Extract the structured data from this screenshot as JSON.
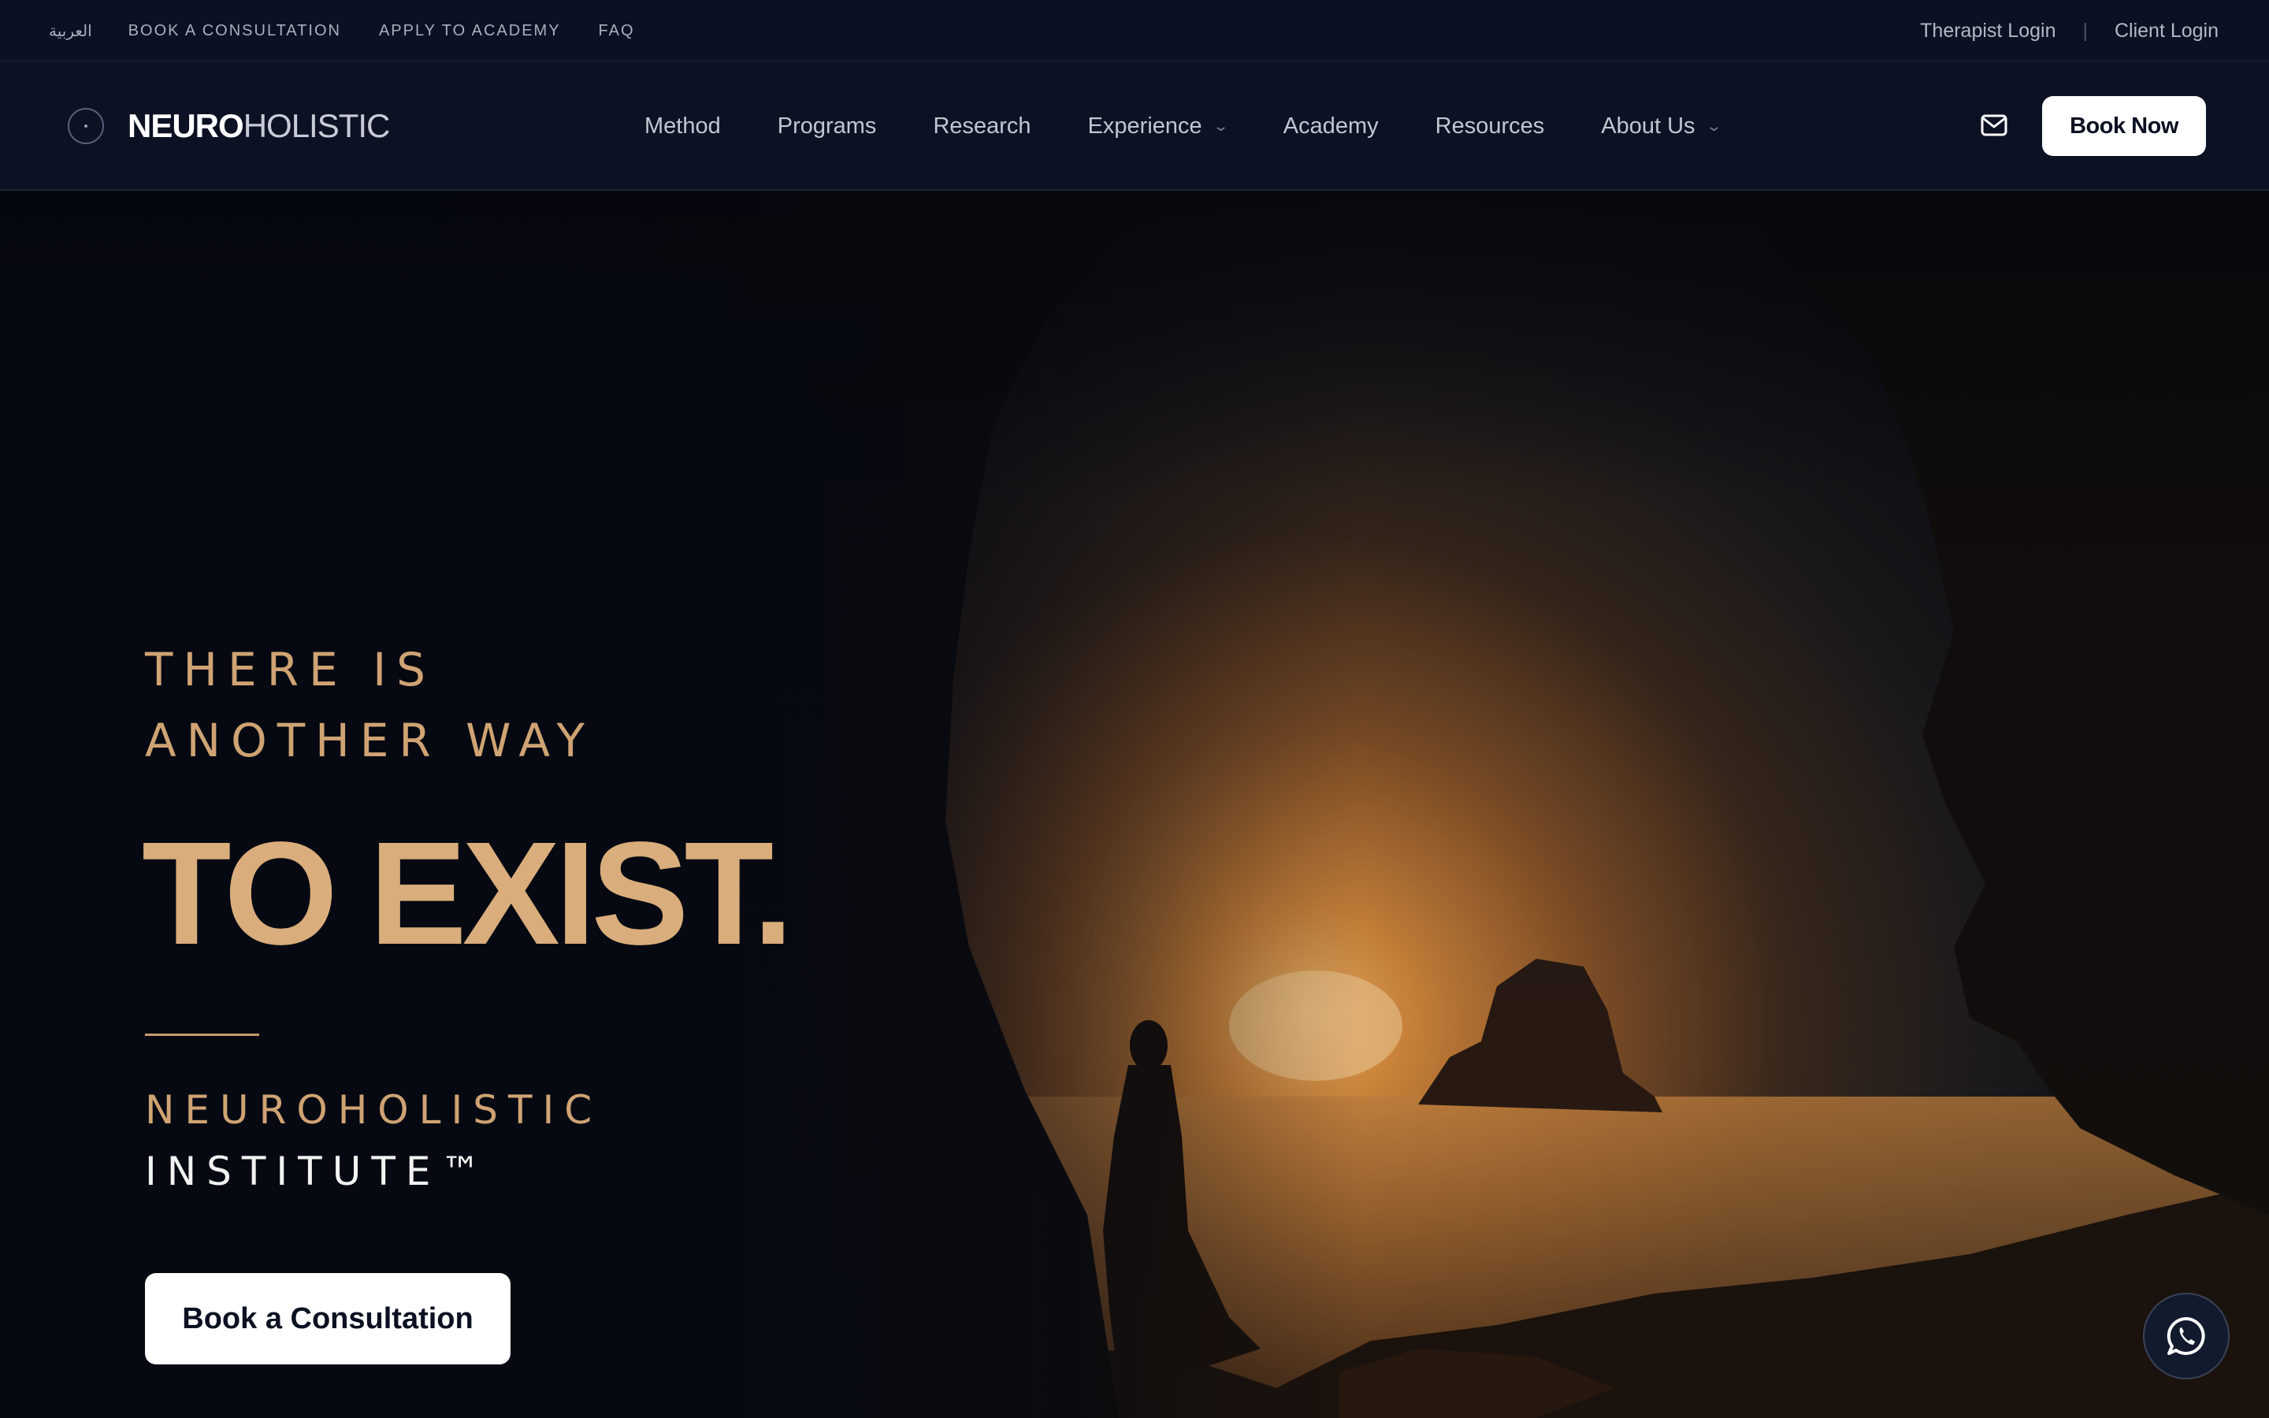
{
  "utility_bar": {
    "links": [
      "العربية",
      "BOOK A CONSULTATION",
      "APPLY TO ACADEMY",
      "FAQ"
    ],
    "therapist_login": "Therapist Login",
    "separator": "|",
    "client_login": "Client Login"
  },
  "logo": {
    "bold": "NEURO",
    "light": "HOLISTIC"
  },
  "nav": {
    "items": [
      {
        "label": "Method",
        "dropdown": false
      },
      {
        "label": "Programs",
        "dropdown": false
      },
      {
        "label": "Research",
        "dropdown": false
      },
      {
        "label": "Experience",
        "dropdown": true
      },
      {
        "label": "Academy",
        "dropdown": false
      },
      {
        "label": "Resources",
        "dropdown": false
      },
      {
        "label": "About Us",
        "dropdown": true
      }
    ],
    "mail_icon": "mail-icon",
    "book_now": "Book Now"
  },
  "hero": {
    "eyebrow_line1": "THERE IS",
    "eyebrow_line2": "ANOTHER WAY",
    "headline": "TO EXIST.",
    "institute_line1": "NEUROHOLISTIC",
    "institute_line2": "INSTITUTE™",
    "cta": "Book a Consultation",
    "floating_icon": "whatsapp-icon"
  },
  "colors": {
    "background": "#070b15",
    "nav_bg": "#0c1224",
    "accent_gold": "#d9ad7c",
    "button_bg": "#ffffff"
  }
}
